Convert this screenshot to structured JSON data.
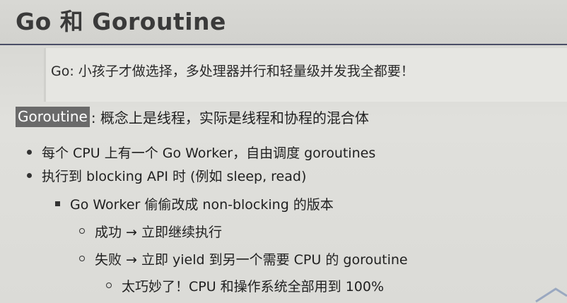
{
  "slide": {
    "title": "Go 和 Goroutine",
    "quote": "Go: 小孩子才做选择，多处理器并行和轻量级并发我全都要！",
    "lead": {
      "keyword": "Goroutine",
      "rest": ": 概念上是线程，实际是线程和协程的混合体"
    },
    "bullets": [
      {
        "level": 1,
        "text": "每个 CPU 上有一个 Go Worker，自由调度 goroutines"
      },
      {
        "level": 1,
        "text": "执行到 blocking API 时 (例如 sleep, read)"
      },
      {
        "level": 2,
        "text": "Go Worker 偷偷改成 non-blocking 的版本"
      },
      {
        "level": 3,
        "text": "成功 → 立即继续执行"
      },
      {
        "level": 3,
        "text": "失败 → 立即 yield 到另一个需要 CPU 的 goroutine"
      },
      {
        "level": 4,
        "text": "太巧妙了！CPU 和操作系统全部用到 100%"
      }
    ]
  },
  "colors": {
    "title_rule": "#4a4e66",
    "keyword_bg": "#6a6a6a",
    "text": "#1f1f1f"
  }
}
